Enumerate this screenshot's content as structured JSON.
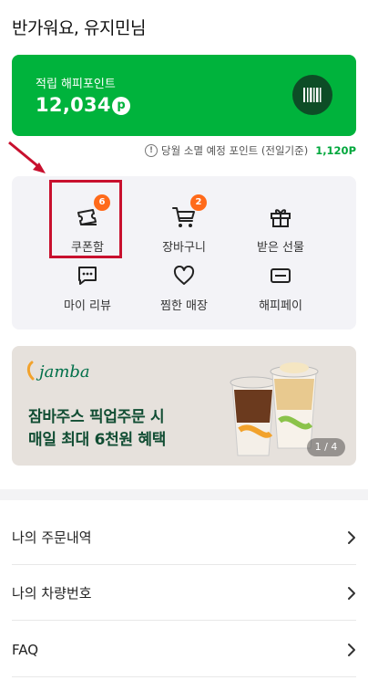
{
  "header": {
    "greeting": "반가워요, 유지민님"
  },
  "point_card": {
    "label": "적립 해피포인트",
    "amount": "12,034",
    "badge": "p",
    "bg_color": "#00b33c"
  },
  "expire": {
    "text": "당월 소멸 예정 포인트 (전일기준)",
    "value": "1,120P"
  },
  "menu": [
    {
      "label": "쿠폰함",
      "icon": "ticket-icon",
      "badge": "6"
    },
    {
      "label": "장바구니",
      "icon": "cart-icon",
      "badge": "2"
    },
    {
      "label": "받은 선물",
      "icon": "gift-icon"
    },
    {
      "label": "마이 리뷰",
      "icon": "chat-bubble-icon"
    },
    {
      "label": "찜한 매장",
      "icon": "heart-icon"
    },
    {
      "label": "해피페이",
      "icon": "card-icon"
    }
  ],
  "banner": {
    "brand": "jamba",
    "line1": "잠바주스 픽업주문 시",
    "line2": "매일 최대 6천원 혜택",
    "pager": "1 / 4"
  },
  "list": [
    {
      "label": "나의 주문내역"
    },
    {
      "label": "나의 차량번호"
    },
    {
      "label": "FAQ"
    }
  ],
  "colors": {
    "accent": "#00b33c",
    "badge": "#ff6a1a",
    "highlight": "#c8102e"
  }
}
